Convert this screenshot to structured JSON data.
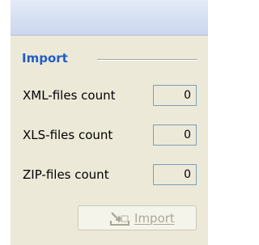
{
  "import_section": {
    "title": "Import",
    "fields": [
      {
        "label": "XML-files count",
        "value": "0"
      },
      {
        "label": "XLS-files count",
        "value": "0"
      },
      {
        "label": "ZIP-files count",
        "value": "0"
      }
    ],
    "import_button": {
      "label": "Import",
      "icon": "import-arrow-icon",
      "state": "disabled"
    }
  },
  "colors": {
    "header_gradient_top": "#e4ebf7",
    "header_gradient_bottom": "#cbd7ee",
    "panel_background": "#ece9d8",
    "section_title": "#215dc6",
    "disabled_text": "#aca899"
  }
}
